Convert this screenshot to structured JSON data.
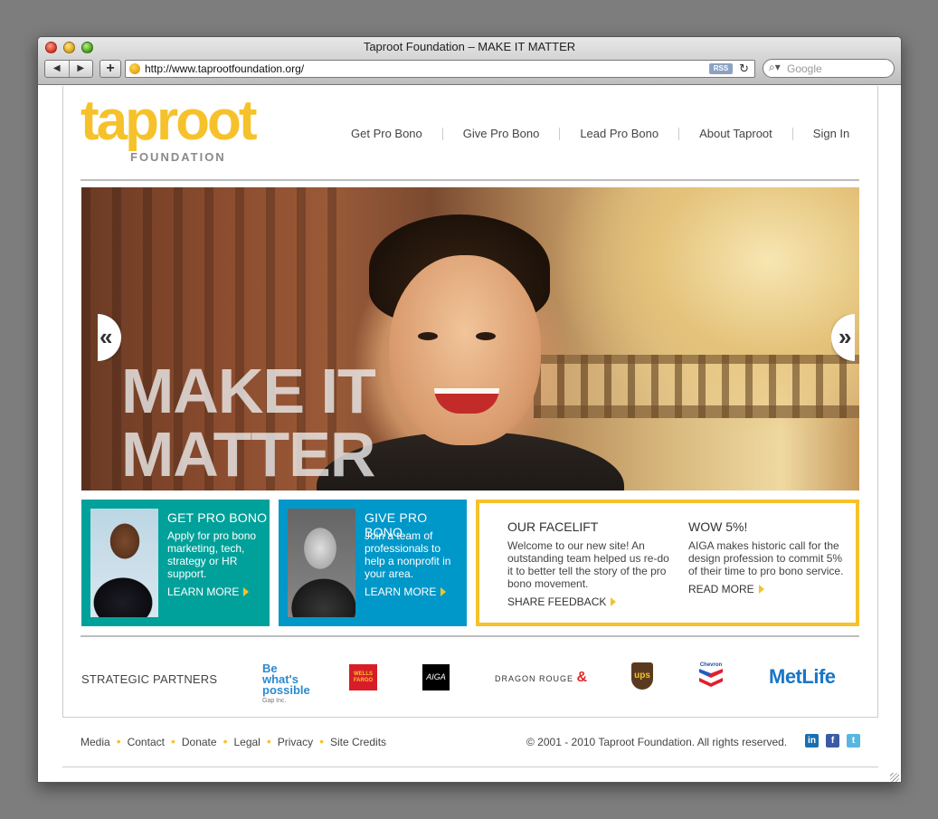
{
  "browser": {
    "title": "Taproot Foundation – MAKE IT MATTER",
    "back_icon": "◀",
    "forward_icon": "▶",
    "add_icon": "+",
    "url": "http://www.taprootfoundation.org/",
    "rss": "RSS",
    "reload_icon": "↻",
    "search_placeholder": "Google",
    "search_icon": "🔍"
  },
  "logo": {
    "word": "taproot",
    "sub": "FOUNDATION"
  },
  "nav": {
    "items": [
      {
        "label": "Get Pro Bono"
      },
      {
        "label": "Give Pro Bono"
      },
      {
        "label": "Lead Pro Bono"
      },
      {
        "label": "About Taproot"
      },
      {
        "label": "Sign In"
      }
    ]
  },
  "hero": {
    "line1": "MAKE IT",
    "line2": "MATTER",
    "prev_icon": "«",
    "next_icon": "»"
  },
  "promos": [
    {
      "title": "GET PRO BONO",
      "text": "Apply for pro bono marketing, tech, strategy or HR support.",
      "link": "LEARN MORE",
      "color": "#00a19a"
    },
    {
      "title": "GIVE PRO BONO",
      "text": "Join a team of professionals to help a nonprofit in your area.",
      "link": "LEARN MORE",
      "color": "#0097c9"
    }
  ],
  "news": [
    {
      "title": "OUR FACELIFT",
      "text": "Welcome to our new site! An outstanding team helped us re-do it to better tell the story of the pro bono movement.",
      "link": "SHARE FEEDBACK"
    },
    {
      "title": "WOW 5%!",
      "text": "AIGA makes historic call for the design profession to commit 5% of their time to pro bono service.",
      "link": "READ MORE"
    }
  ],
  "partners": {
    "label": "STRATEGIC PARTNERS",
    "logos": {
      "gap_main": "Be what's possible",
      "gap_sub": "Gap Inc.",
      "wellsfargo": "WELLS FARGO",
      "aiga": "AIGA",
      "dragon": "DRAGON ROUGE",
      "dragon_mark": "&",
      "ups": "ups",
      "chevron": "Chevron",
      "metlife": "MetLife"
    }
  },
  "footer": {
    "links": [
      {
        "label": "Media"
      },
      {
        "label": "Contact"
      },
      {
        "label": "Donate"
      },
      {
        "label": "Legal"
      },
      {
        "label": "Privacy"
      },
      {
        "label": "Site Credits"
      }
    ],
    "copyright": "© 2001 - 2010 Taproot Foundation. All rights reserved.",
    "social": {
      "linkedin": "in",
      "facebook": "f",
      "twitter": "t"
    }
  },
  "colors": {
    "brand_yellow": "#f6c22b",
    "teal": "#00a19a",
    "blue": "#0097c9"
  }
}
